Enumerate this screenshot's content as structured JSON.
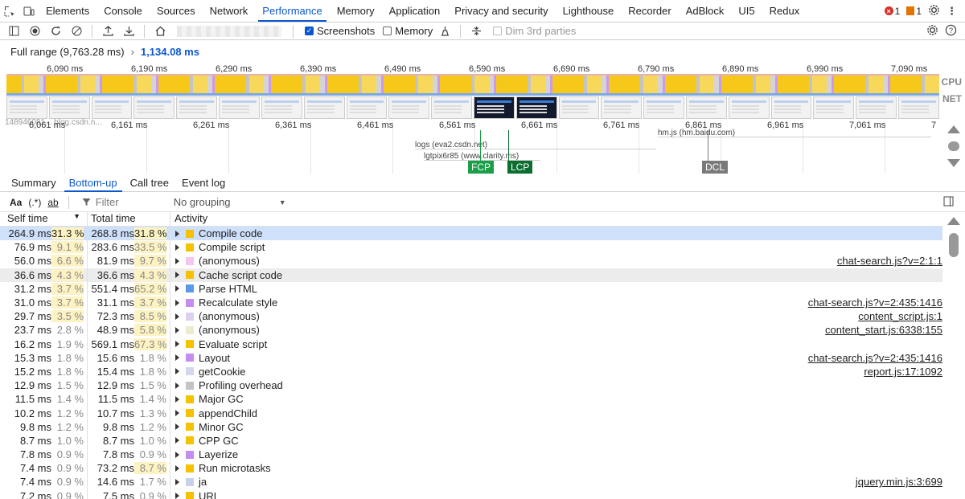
{
  "tabs": [
    "Elements",
    "Console",
    "Sources",
    "Network",
    "Performance",
    "Memory",
    "Application",
    "Privacy and security",
    "Lighthouse",
    "Recorder",
    "AdBlock",
    "UI5",
    "Redux"
  ],
  "active_tab": "Performance",
  "badges": {
    "errors": "1",
    "warnings": "1"
  },
  "toolbar": {
    "screenshots": "Screenshots",
    "memory": "Memory",
    "dim": "Dim 3rd parties"
  },
  "range": {
    "full": "Full range (9,763.28 ms)",
    "arrow": "›",
    "current": "1,134.08 ms"
  },
  "overview_ticks": [
    "6,090 ms",
    "6,190 ms",
    "6,290 ms",
    "6,390 ms",
    "6,490 ms",
    "6,590 ms",
    "6,690 ms",
    "6,790 ms",
    "6,890 ms",
    "6,990 ms",
    "7,090 ms"
  ],
  "overview_labels": {
    "cpu": "CPU",
    "net": "NET"
  },
  "detail_ticks": [
    "6,061 ms",
    "6,161 ms",
    "6,261 ms",
    "6,361 ms",
    "6,461 ms",
    "6,561 ms",
    "6,661 ms",
    "6,761 ms",
    "6,861 ms",
    "6,961 ms",
    "7,061 ms",
    "7"
  ],
  "detail_url_snip": "148946081... blog.csdn.n...",
  "network_bars": [
    "hm.js (hm.baidu.com)",
    "logs (eva2.csdn.net)",
    "lgtpix6r85 (www.clarity.ms)"
  ],
  "markers": {
    "fcp": "FCP",
    "lcp": "LCP",
    "dcl": "DCL"
  },
  "bottom_tabs": [
    "Summary",
    "Bottom-up",
    "Call tree",
    "Event log"
  ],
  "active_bottom_tab": "Bottom-up",
  "filter": {
    "aa": "Aa",
    "regex": "(.*)",
    "word": "ab",
    "placeholder": "Filter",
    "grouping": "No grouping"
  },
  "columns": {
    "self": "Self time",
    "total": "Total time",
    "activity": "Activity"
  },
  "rows": [
    {
      "self_ms": "264.9 ms",
      "self_pct": "31.3 %",
      "total_ms": "268.8 ms",
      "total_pct": "31.8 %",
      "activity": "Compile code",
      "color": "#f4c200",
      "link": ""
    },
    {
      "self_ms": "76.9 ms",
      "self_pct": "9.1 %",
      "total_ms": "283.6 ms",
      "total_pct": "33.5 %",
      "activity": "Compile script",
      "color": "#f4c200",
      "link": ""
    },
    {
      "self_ms": "56.0 ms",
      "self_pct": "6.6 %",
      "total_ms": "81.9 ms",
      "total_pct": "9.7 %",
      "activity": "(anonymous)",
      "color": "#f2c6ee",
      "link": "chat-search.js?v=2:1:1"
    },
    {
      "self_ms": "36.6 ms",
      "self_pct": "4.3 %",
      "total_ms": "36.6 ms",
      "total_pct": "4.3 %",
      "activity": "Cache script code",
      "color": "#f4c200",
      "link": ""
    },
    {
      "self_ms": "31.2 ms",
      "self_pct": "3.7 %",
      "total_ms": "551.4 ms",
      "total_pct": "65.2 %",
      "activity": "Parse HTML",
      "color": "#5b9ae8",
      "link": ""
    },
    {
      "self_ms": "31.0 ms",
      "self_pct": "3.7 %",
      "total_ms": "31.1 ms",
      "total_pct": "3.7 %",
      "activity": "Recalculate style",
      "color": "#c58df0",
      "link": "chat-search.js?v=2:435:1416"
    },
    {
      "self_ms": "29.7 ms",
      "self_pct": "3.5 %",
      "total_ms": "72.3 ms",
      "total_pct": "8.5 %",
      "activity": "(anonymous)",
      "color": "#dcd0ef",
      "link": "content_script.js:1"
    },
    {
      "self_ms": "23.7 ms",
      "self_pct": "2.8 %",
      "total_ms": "48.9 ms",
      "total_pct": "5.8 %",
      "activity": "(anonymous)",
      "color": "#efead0",
      "link": "content_start.js:6338:155"
    },
    {
      "self_ms": "16.2 ms",
      "self_pct": "1.9 %",
      "total_ms": "569.1 ms",
      "total_pct": "67.3 %",
      "activity": "Evaluate script",
      "color": "#f4c200",
      "link": ""
    },
    {
      "self_ms": "15.3 ms",
      "self_pct": "1.8 %",
      "total_ms": "15.6 ms",
      "total_pct": "1.8 %",
      "activity": "Layout",
      "color": "#c58df0",
      "link": "chat-search.js?v=2:435:1416"
    },
    {
      "self_ms": "15.2 ms",
      "self_pct": "1.8 %",
      "total_ms": "15.4 ms",
      "total_pct": "1.8 %",
      "activity": "getCookie",
      "color": "#d6d6ef",
      "link": "report.js:17:1092"
    },
    {
      "self_ms": "12.9 ms",
      "self_pct": "1.5 %",
      "total_ms": "12.9 ms",
      "total_pct": "1.5 %",
      "activity": "Profiling overhead",
      "color": "#c4c4c4",
      "link": ""
    },
    {
      "self_ms": "11.5 ms",
      "self_pct": "1.4 %",
      "total_ms": "11.5 ms",
      "total_pct": "1.4 %",
      "activity": "Major GC",
      "color": "#f4c200",
      "link": ""
    },
    {
      "self_ms": "10.2 ms",
      "self_pct": "1.2 %",
      "total_ms": "10.7 ms",
      "total_pct": "1.3 %",
      "activity": "appendChild",
      "color": "#f4c200",
      "link": ""
    },
    {
      "self_ms": "9.8 ms",
      "self_pct": "1.2 %",
      "total_ms": "9.8 ms",
      "total_pct": "1.2 %",
      "activity": "Minor GC",
      "color": "#f4c200",
      "link": ""
    },
    {
      "self_ms": "8.7 ms",
      "self_pct": "1.0 %",
      "total_ms": "8.7 ms",
      "total_pct": "1.0 %",
      "activity": "CPP GC",
      "color": "#f4c200",
      "link": ""
    },
    {
      "self_ms": "7.8 ms",
      "self_pct": "0.9 %",
      "total_ms": "7.8 ms",
      "total_pct": "0.9 %",
      "activity": "Layerize",
      "color": "#c58df0",
      "link": ""
    },
    {
      "self_ms": "7.4 ms",
      "self_pct": "0.9 %",
      "total_ms": "73.2 ms",
      "total_pct": "8.7 %",
      "activity": "Run microtasks",
      "color": "#f4c200",
      "link": ""
    },
    {
      "self_ms": "7.4 ms",
      "self_pct": "0.9 %",
      "total_ms": "14.6 ms",
      "total_pct": "1.7 %",
      "activity": "ja",
      "color": "#c9d0ec",
      "link": "jquery.min.js:3:699"
    },
    {
      "self_ms": "7.2 ms",
      "self_pct": "0.9 %",
      "total_ms": "7.5 ms",
      "total_pct": "0.9 %",
      "activity": "URL",
      "color": "#f4c200",
      "link": ""
    }
  ]
}
